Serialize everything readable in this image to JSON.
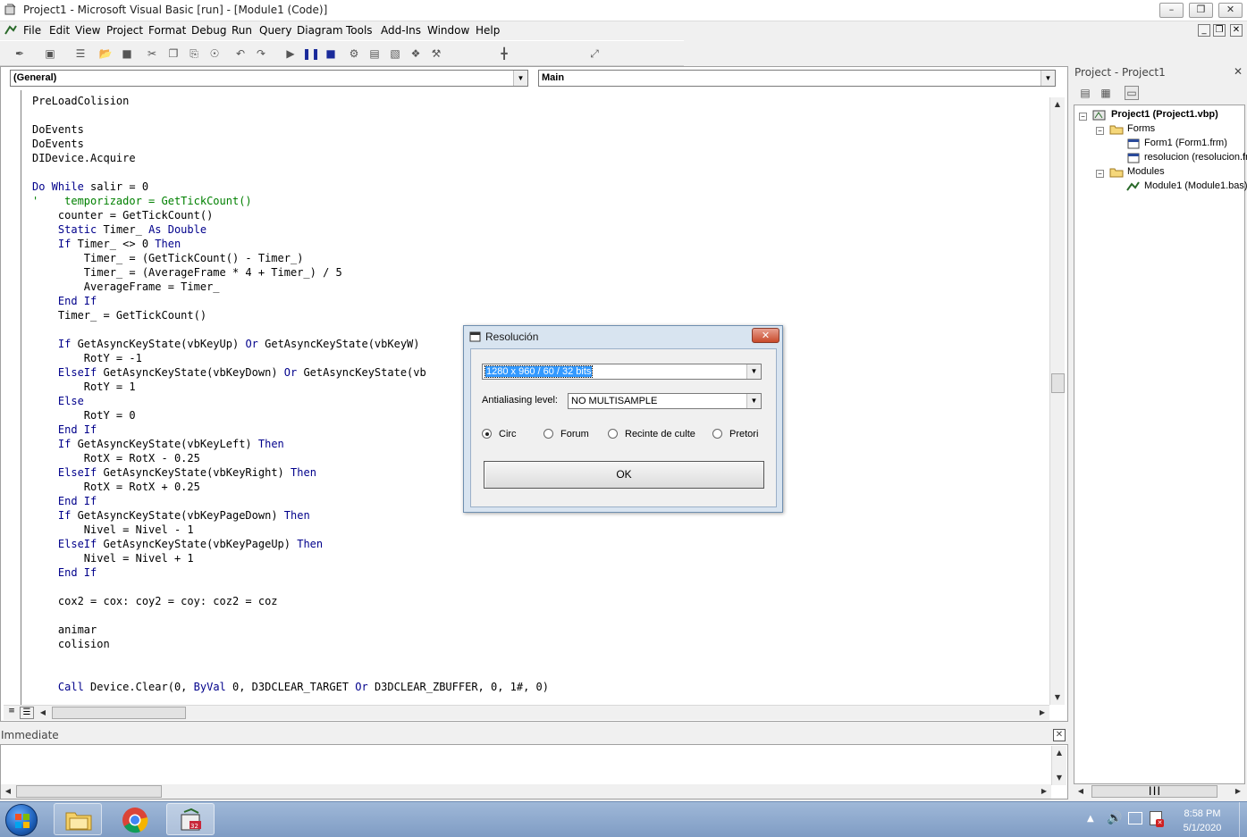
{
  "window": {
    "title": "Project1 - Microsoft Visual Basic [run] - [Module1 (Code)]"
  },
  "menu": [
    "File",
    "Edit",
    "View",
    "Project",
    "Format",
    "Debug",
    "Run",
    "Query",
    "Diagram",
    "Tools",
    "Add-Ins",
    "Window",
    "Help"
  ],
  "editor": {
    "object_combo": "(General)",
    "procedure_combo": "Main",
    "code_lines": [
      [
        {
          "t": "PreLoadColision"
        }
      ],
      [
        {
          "t": ""
        }
      ],
      [
        {
          "t": "DoEvents"
        }
      ],
      [
        {
          "t": "DoEvents"
        }
      ],
      [
        {
          "t": "DIDevice.Acquire"
        }
      ],
      [
        {
          "t": ""
        }
      ],
      [
        {
          "t": "Do While",
          "c": "kw"
        },
        {
          "t": " salir = 0"
        }
      ],
      [
        {
          "t": "'    temporizador = GetTickCount()",
          "c": "cm"
        }
      ],
      [
        {
          "t": "    counter = GetTickCount()"
        }
      ],
      [
        {
          "t": "    "
        },
        {
          "t": "Static",
          "c": "kw"
        },
        {
          "t": " Timer_ "
        },
        {
          "t": "As Double",
          "c": "kw"
        }
      ],
      [
        {
          "t": "    "
        },
        {
          "t": "If",
          "c": "kw"
        },
        {
          "t": " Timer_ <> 0 "
        },
        {
          "t": "Then",
          "c": "kw"
        }
      ],
      [
        {
          "t": "        Timer_ = (GetTickCount() - Timer_)"
        }
      ],
      [
        {
          "t": "        Timer_ = (AverageFrame * 4 + Timer_) / 5"
        }
      ],
      [
        {
          "t": "        AverageFrame = Timer_"
        }
      ],
      [
        {
          "t": "    "
        },
        {
          "t": "End If",
          "c": "kw"
        }
      ],
      [
        {
          "t": "    Timer_ = GetTickCount()"
        }
      ],
      [
        {
          "t": ""
        }
      ],
      [
        {
          "t": "    "
        },
        {
          "t": "If",
          "c": "kw"
        },
        {
          "t": " GetAsyncKeyState(vbKeyUp) "
        },
        {
          "t": "Or",
          "c": "kw"
        },
        {
          "t": " GetAsyncKeyState(vbKeyW)"
        }
      ],
      [
        {
          "t": "        RotY = -1"
        }
      ],
      [
        {
          "t": "    "
        },
        {
          "t": "ElseIf",
          "c": "kw"
        },
        {
          "t": " GetAsyncKeyState(vbKeyDown) "
        },
        {
          "t": "Or",
          "c": "kw"
        },
        {
          "t": " GetAsyncKeyState(vb"
        }
      ],
      [
        {
          "t": "        RotY = 1"
        }
      ],
      [
        {
          "t": "    "
        },
        {
          "t": "Else",
          "c": "kw"
        }
      ],
      [
        {
          "t": "        RotY = 0"
        }
      ],
      [
        {
          "t": "    "
        },
        {
          "t": "End If",
          "c": "kw"
        }
      ],
      [
        {
          "t": "    "
        },
        {
          "t": "If",
          "c": "kw"
        },
        {
          "t": " GetAsyncKeyState(vbKeyLeft) "
        },
        {
          "t": "Then",
          "c": "kw"
        }
      ],
      [
        {
          "t": "        RotX = RotX - 0.25"
        }
      ],
      [
        {
          "t": "    "
        },
        {
          "t": "ElseIf",
          "c": "kw"
        },
        {
          "t": " GetAsyncKeyState(vbKeyRight) "
        },
        {
          "t": "Then",
          "c": "kw"
        }
      ],
      [
        {
          "t": "        RotX = RotX + 0.25"
        }
      ],
      [
        {
          "t": "    "
        },
        {
          "t": "End If",
          "c": "kw"
        }
      ],
      [
        {
          "t": "    "
        },
        {
          "t": "If",
          "c": "kw"
        },
        {
          "t": " GetAsyncKeyState(vbKeyPageDown) "
        },
        {
          "t": "Then",
          "c": "kw"
        }
      ],
      [
        {
          "t": "        Nivel = Nivel - 1"
        }
      ],
      [
        {
          "t": "    "
        },
        {
          "t": "ElseIf",
          "c": "kw"
        },
        {
          "t": " GetAsyncKeyState(vbKeyPageUp) "
        },
        {
          "t": "Then",
          "c": "kw"
        }
      ],
      [
        {
          "t": "        Nivel = Nivel + 1"
        }
      ],
      [
        {
          "t": "    "
        },
        {
          "t": "End If",
          "c": "kw"
        }
      ],
      [
        {
          "t": ""
        }
      ],
      [
        {
          "t": "    cox2 = cox: coy2 = coy: coz2 = coz"
        }
      ],
      [
        {
          "t": ""
        }
      ],
      [
        {
          "t": "    animar"
        }
      ],
      [
        {
          "t": "    colision"
        }
      ],
      [
        {
          "t": ""
        }
      ],
      [
        {
          "t": ""
        }
      ],
      [
        {
          "t": "    "
        },
        {
          "t": "Call",
          "c": "kw"
        },
        {
          "t": " Device.Clear(0, "
        },
        {
          "t": "ByVal",
          "c": "kw"
        },
        {
          "t": " 0, D3DCLEAR_TARGET "
        },
        {
          "t": "Or",
          "c": "kw"
        },
        {
          "t": " D3DCLEAR_ZBUFFER, 0, 1#, 0)"
        }
      ]
    ],
    "colors": {
      "keyword": "#00008b",
      "comment": "#008000"
    }
  },
  "immediate": {
    "title": "Immediate"
  },
  "project": {
    "title": "Project - Project1",
    "root": "Project1 (Project1.vbp)",
    "forms_label": "Forms",
    "form1": "Form1 (Form1.frm)",
    "form2": "resolucion (resolucion.fr",
    "modules_label": "Modules",
    "module1": "Module1 (Module1.bas)"
  },
  "dialog": {
    "title": "Resolución",
    "resolution_value": "1280 x 960 / 60 / 32 bits",
    "aa_label": "Antialiasing level:",
    "aa_value": "NO MULTISAMPLE",
    "options": [
      "Circ",
      "Forum",
      "Recinte de culte",
      "Pretori"
    ],
    "selected_option": "Circ",
    "ok_label": "OK"
  },
  "clock": {
    "time": "8:58 PM",
    "date": "5/1/2020"
  }
}
